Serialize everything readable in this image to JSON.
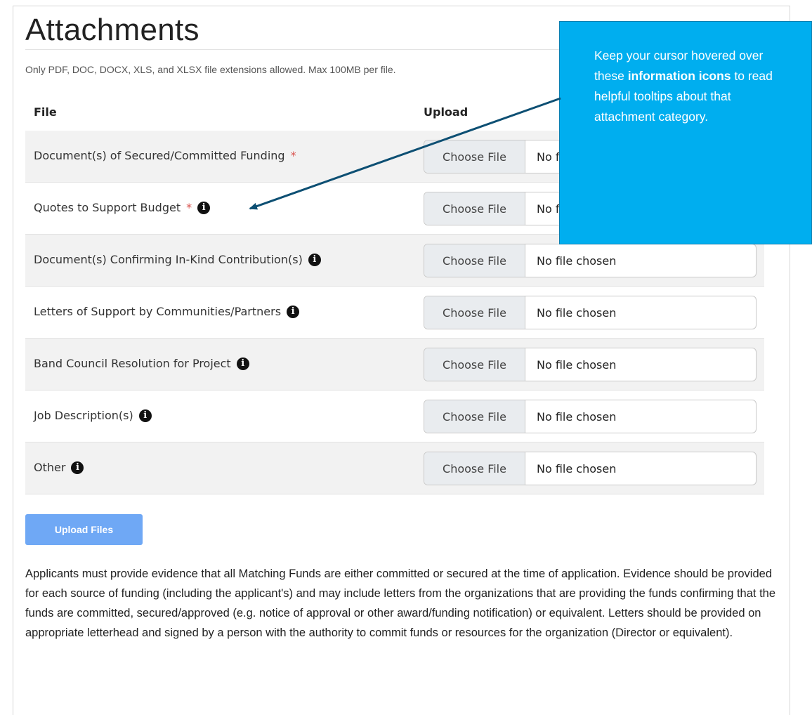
{
  "page": {
    "title": "Attachments",
    "subtitle": "Only PDF, DOC, DOCX, XLS, and XLSX file extensions allowed. Max 100MB per file."
  },
  "table": {
    "headers": {
      "file": "File",
      "upload": "Upload"
    },
    "rows": [
      {
        "label": "Document(s) of Secured/Committed Funding",
        "required": "*",
        "info": "",
        "button": "Choose File",
        "status": "No file chosen"
      },
      {
        "label": "Quotes to Support Budget",
        "required": "*",
        "info": "i",
        "button": "Choose File",
        "status": "No file chosen"
      },
      {
        "label": "Document(s) Confirming In-Kind Contribution(s)",
        "required": "",
        "info": "i",
        "button": "Choose File",
        "status": "No file chosen"
      },
      {
        "label": "Letters of Support by Communities/Partners",
        "required": "",
        "info": "i",
        "button": "Choose File",
        "status": "No file chosen"
      },
      {
        "label": "Band Council Resolution for Project",
        "required": "",
        "info": "i",
        "button": "Choose File",
        "status": "No file chosen"
      },
      {
        "label": "Job Description(s)",
        "required": "",
        "info": "i",
        "button": "Choose File",
        "status": "No file chosen"
      },
      {
        "label": "Other",
        "required": "",
        "info": "i",
        "button": "Choose File",
        "status": "No file chosen"
      }
    ]
  },
  "actions": {
    "upload_label": "Upload Files"
  },
  "note": "Applicants must provide evidence that all Matching Funds are either committed or secured at the time of application. Evidence should be provided for each source of funding (including the applicant's) and may include letters from the organizations that are providing the funds confirming that the funds are committed, secured/approved (e.g. notice of approval or other award/funding notification) or equivalent. Letters should be provided on appropriate letterhead and signed by a person with the authority to commit funds or resources for the organization (Director or equivalent).",
  "callout": {
    "text_before": "Keep your cursor hovered over these ",
    "text_bold": "information icons",
    "text_after": " to read helpful tooltips about that attachment category."
  },
  "colors": {
    "callout_bg": "#00aeef",
    "arrow": "#0d4f73",
    "required": "#d9534f",
    "upload_button": "#6fa8f5"
  },
  "icons": {
    "info": "info-circle-icon"
  }
}
